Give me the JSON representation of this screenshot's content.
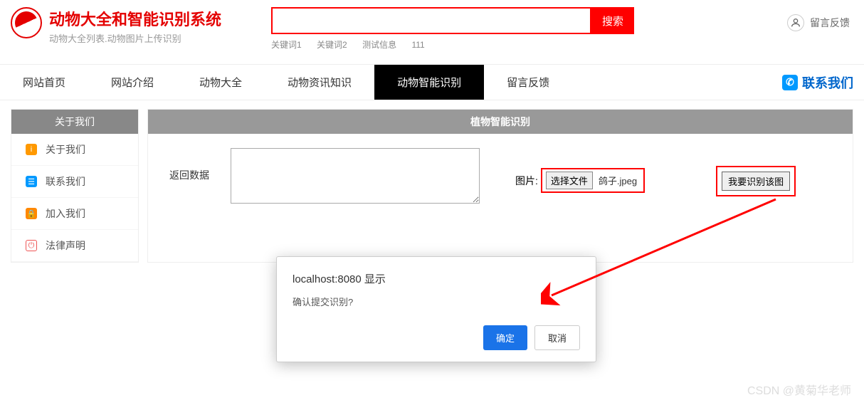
{
  "header": {
    "title": "动物大全和智能识别系统",
    "subtitle": "动物大全列表.动物图片上传识别",
    "search_button": "搜索",
    "keywords": [
      "关键词1",
      "关键词2",
      "测试信息",
      "111"
    ],
    "feedback": "留言反馈"
  },
  "nav": {
    "items": [
      "网站首页",
      "网站介绍",
      "动物大全",
      "动物资讯知识",
      "动物智能识别",
      "留言反馈"
    ],
    "active_index": 4,
    "contact": "联系我们"
  },
  "sidebar": {
    "title": "关于我们",
    "items": [
      {
        "label": "关于我们",
        "color": "#f90"
      },
      {
        "label": "联系我们",
        "color": "#09f"
      },
      {
        "label": "加入我们",
        "color": "#f80"
      },
      {
        "label": "法律声明",
        "color": "#e55"
      }
    ]
  },
  "main": {
    "title": "植物智能识别",
    "return_label": "返回数据",
    "textarea_value": "",
    "image_label": "图片:",
    "file_button": "选择文件",
    "file_name": "鸽子.jpeg",
    "submit_button": "我要识别该图"
  },
  "dialog": {
    "title": "localhost:8080 显示",
    "message": "确认提交识别?",
    "ok": "确定",
    "cancel": "取消"
  },
  "watermark": "CSDN @黄菊华老师"
}
